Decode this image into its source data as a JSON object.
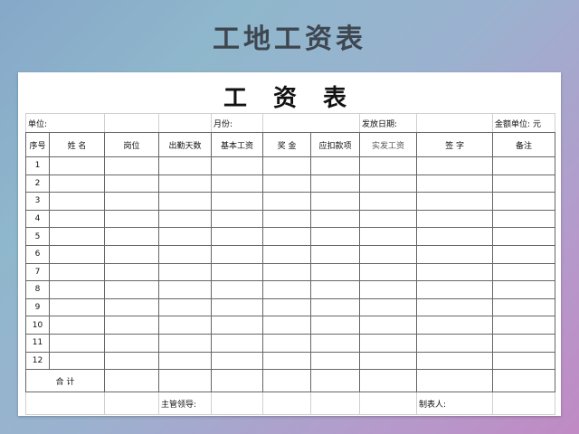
{
  "banner_title": "工地工资表",
  "sheet": {
    "title": "工  资  表",
    "info": {
      "unit_label": "单位:",
      "month_label": "月份:",
      "date_label": "发放日期:",
      "currency_label": "金额单位:",
      "currency_value": "元"
    },
    "headers": [
      "序号",
      "姓  名",
      "岗位",
      "出勤天数",
      "基本工资",
      "奖  金",
      "应扣款项",
      "实发工资",
      "签  字",
      "备注"
    ],
    "row_numbers": [
      "1",
      "2",
      "3",
      "4",
      "5",
      "6",
      "7",
      "8",
      "9",
      "10",
      "11",
      "12"
    ],
    "total_label": "合      计",
    "footer": {
      "supervisor_label": "主管领导:",
      "maker_label": "制表人:"
    }
  }
}
